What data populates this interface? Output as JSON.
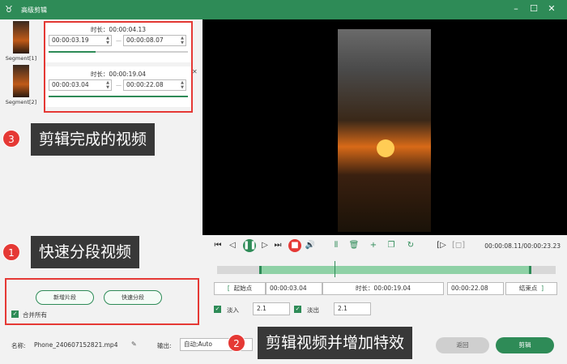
{
  "window": {
    "title": "高级剪辑"
  },
  "segments": [
    {
      "label": "Segment[1]",
      "duration": "时长：00:00:04.13",
      "start": "00:00:03.19",
      "end": "00:00:08.07",
      "progress": 0.34
    },
    {
      "label": "Segment[2]",
      "duration": "时长：00:00:19.04",
      "start": "00:00:03.04",
      "end": "00:00:22.08",
      "progress": 1.0
    }
  ],
  "callouts": [
    {
      "num": "3",
      "text": "剪辑完成的视频"
    },
    {
      "num": "1",
      "text": "快速分段视频"
    },
    {
      "num": "2",
      "text": "剪辑视频并增加特效"
    }
  ],
  "split": {
    "add_label": "新增片段",
    "fast_label": "快速分段",
    "merge_label": "合并所有"
  },
  "player": {
    "timecode": "00:00:08.11/00:00:23.23"
  },
  "timeline": {
    "start_label": "起始点",
    "start_value": "00:00:03.04",
    "duration": "时长：00:00:19.04",
    "end_value": "00:00:22.08",
    "end_label": "结束点",
    "fade_in_label": "淡入",
    "fade_in_value": "2.1",
    "fade_out_label": "淡出",
    "fade_out_value": "2.1"
  },
  "footer": {
    "name_label": "名称:",
    "filename": "Phone_240607152821.mp4",
    "output_label": "输出:",
    "output_value": "自动;Auto",
    "back_label": "返回",
    "cut_label": "剪辑"
  },
  "colors": {
    "accent": "#2e8b57",
    "callout_red": "#e53935"
  }
}
